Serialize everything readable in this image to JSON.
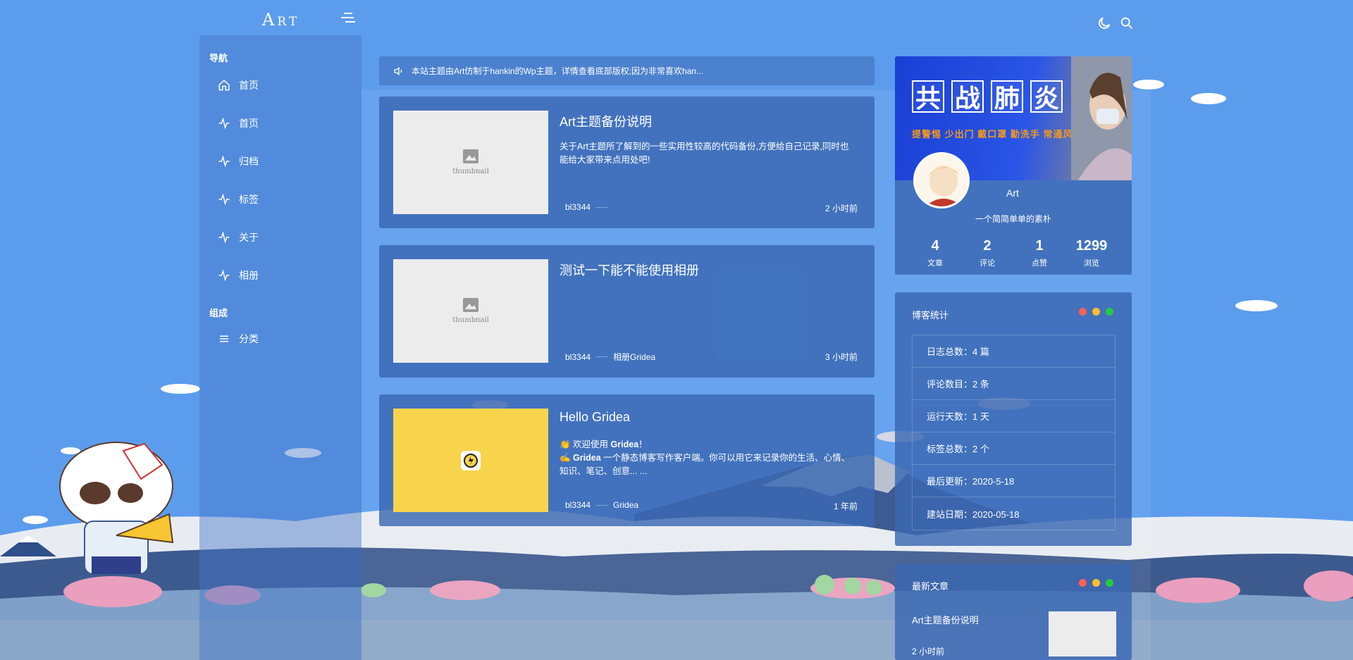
{
  "header": {
    "logo_big": "A",
    "logo_small": "RT",
    "icons": [
      "menu-icon",
      "moon-icon",
      "search-icon"
    ]
  },
  "sidebar": {
    "section_nav": "导航",
    "nav_items": [
      {
        "label": "首页",
        "icon": "home-icon"
      },
      {
        "label": "首页",
        "icon": "activity-icon"
      },
      {
        "label": "归档",
        "icon": "activity-icon"
      },
      {
        "label": "标签",
        "icon": "activity-icon"
      },
      {
        "label": "关于",
        "icon": "activity-icon"
      },
      {
        "label": "相册",
        "icon": "activity-icon"
      }
    ],
    "section_group": "组成",
    "group_items": [
      {
        "label": "分类",
        "icon": "list-icon"
      }
    ]
  },
  "notice": {
    "text": "本站主题由Art仿制于hankin的Wp主题，详情查看底部版权;因为非常喜欢han...",
    "icon": "speaker-icon"
  },
  "posts": [
    {
      "title": "Art主题备份说明",
      "excerpt": "关于Art主题所了解到的一些实用性较高的代码备份,方便给自己记录,同时也能给大家带来点用处吧!",
      "author": "bl3344",
      "tag": "",
      "time": "2 小时前",
      "thumb_text": "thumbnail"
    },
    {
      "title": "测试一下能不能使用相册",
      "excerpt": "",
      "author": "bl3344",
      "tag": "相册Gridea",
      "time": "3 小时前",
      "thumb_text": "thumbnail"
    },
    {
      "title": "Hello Gridea",
      "excerpt_line1_prefix": "👏 欢迎使用 ",
      "excerpt_line1_bold": "Gridea",
      "excerpt_line1_suffix": "！",
      "excerpt_line2_prefix": "✍️ ",
      "excerpt_line2_bold": "Gridea",
      "excerpt_line2_rest": " 一个静态博客写作客户端。你可以用它来记录你的生活、心情、知识、笔记、创意... ...",
      "author": "bl3344",
      "tag": "Gridea",
      "time": "1 年前"
    }
  ],
  "profile": {
    "banner_chars": [
      "共",
      "战",
      "肺",
      "炎"
    ],
    "banner_slogan": "提警惕 少出门 戴口罩 勤洗手 常通风",
    "name": "Art",
    "description": "一个简简单单的素朴",
    "stats": [
      {
        "value": "4",
        "label": "文章"
      },
      {
        "value": "2",
        "label": "评论"
      },
      {
        "value": "1",
        "label": "点赞"
      },
      {
        "value": "1299",
        "label": "浏览"
      }
    ]
  },
  "blog_stats": {
    "title": "博客统计",
    "rows": [
      "日志总数：4 篇",
      "评论数目：2 条",
      "运行天数：1 天",
      "标签总数：2 个",
      "最后更新：2020-5-18",
      "建站日期：2020-05-18"
    ],
    "dot_colors": [
      "#ff5f56",
      "#ffbd2e",
      "#27c93f"
    ]
  },
  "recent": {
    "title": "最新文章",
    "items": [
      {
        "title": "Art主题备份说明",
        "time": "2 小时前"
      }
    ]
  }
}
